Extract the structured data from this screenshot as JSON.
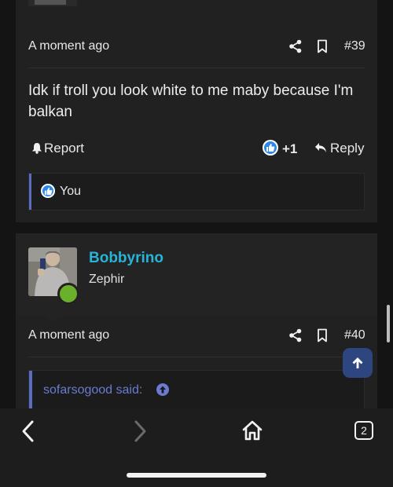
{
  "post39": {
    "time": "A moment ago",
    "number": "#39",
    "body": "Idk if troll you look white to me maby because I'm balkan",
    "report_label": "Report",
    "reaction_count": "+1",
    "reply_label": "Reply",
    "liked_by": "You"
  },
  "post40": {
    "user_name": "Bobbyrino",
    "user_title": "Zephir",
    "time": "A moment ago",
    "number": "#40",
    "quote_label": "sofarsogood said:"
  },
  "browser": {
    "tab_count": "2"
  },
  "colors": {
    "accent_link": "#27b4d6",
    "quote_accent": "#6a7bd0",
    "like_blue": "#2e89e6",
    "online_green": "#6ab02a",
    "fab_blue": "#2d4680"
  },
  "icons": [
    "share-icon",
    "bookmark-icon",
    "bell-icon",
    "like-icon",
    "reply-icon",
    "arrow-up-icon",
    "back-icon",
    "forward-icon",
    "home-icon"
  ]
}
